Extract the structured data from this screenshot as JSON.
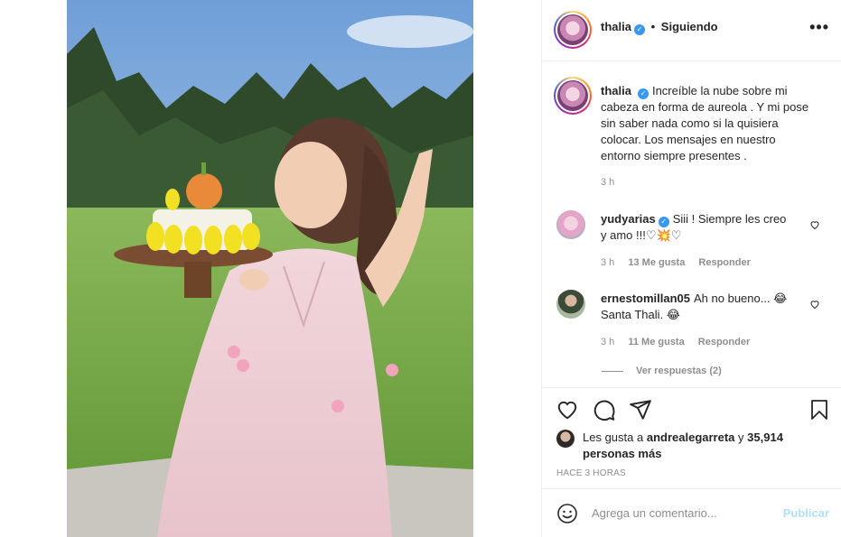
{
  "post_image": {
    "alt_icon": "photo-woman-with-cake"
  },
  "header": {
    "username": "thalia",
    "separator": "•",
    "follow_status": "Siguiendo",
    "more_icon": "•••"
  },
  "caption": {
    "username": "thalia",
    "text": "Increíble la nube sobre mi cabeza en forma de aureola . Y mi pose sin saber nada como si la quisiera colocar. Los mensajes en nuestro entorno siempre presentes .",
    "time": "3 h"
  },
  "comments": [
    {
      "username": "yudyarias",
      "verified": true,
      "text": "Siii ! Siempre les creo y amo !!!♡💥♡",
      "time": "3 h",
      "likes": "13 Me gusta",
      "reply": "Responder"
    },
    {
      "username": "ernestomillan05",
      "verified": false,
      "text": "Ah no bueno... 😂 Santa Thali. 😂",
      "time": "3 h",
      "likes": "11 Me gusta",
      "reply": "Responder"
    }
  ],
  "view_replies": "Ver respuestas (2)",
  "likes": {
    "prefix": "Les gusta a",
    "user": "andrealegarreta",
    "connector": "y",
    "count": "35,914 personas más"
  },
  "posted_ago": "HACE 3 HORAS",
  "add_comment": {
    "placeholder": "Agrega un comentario...",
    "publish": "Publicar"
  },
  "colors": {
    "verified_blue": "#3897f0",
    "publish_disabled": "#b2dffc",
    "meta_gray": "#8e8e8e"
  }
}
